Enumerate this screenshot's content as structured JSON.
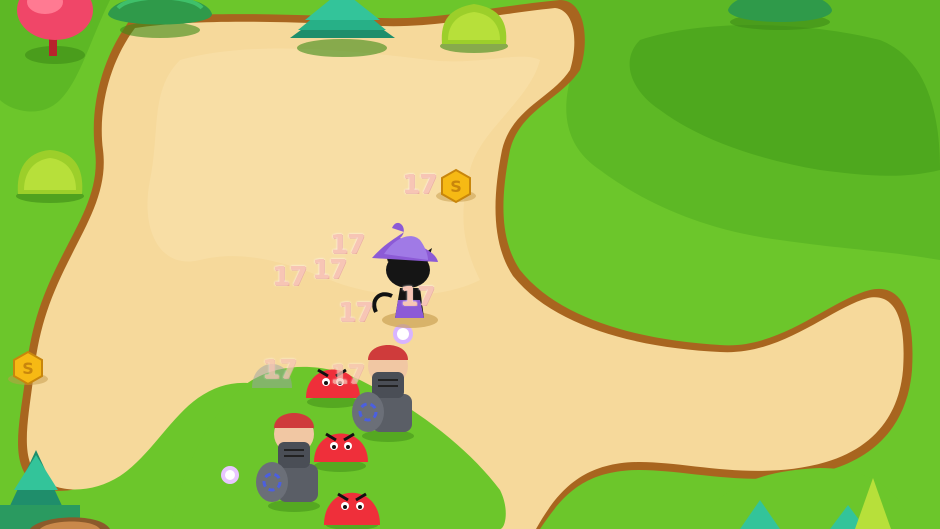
{
  "damage_popups": [
    {
      "text": "17"
    },
    {
      "text": "17"
    },
    {
      "text": "17"
    },
    {
      "text": "17"
    },
    {
      "text": "17"
    },
    {
      "text": "17"
    },
    {
      "text": "17"
    },
    {
      "text": "17"
    }
  ],
  "coin_glyph": "S",
  "colors": {
    "grass": "#6cc62b",
    "grass_dark": "#4fa51f",
    "path_sand": "#f6d99b",
    "path_edge": "#a8651f",
    "enemy_red": "#ef2f3a",
    "knight_armor": "#5a5e66",
    "witch_purple": "#8c5ad6",
    "coin_gold": "#f6b914"
  }
}
